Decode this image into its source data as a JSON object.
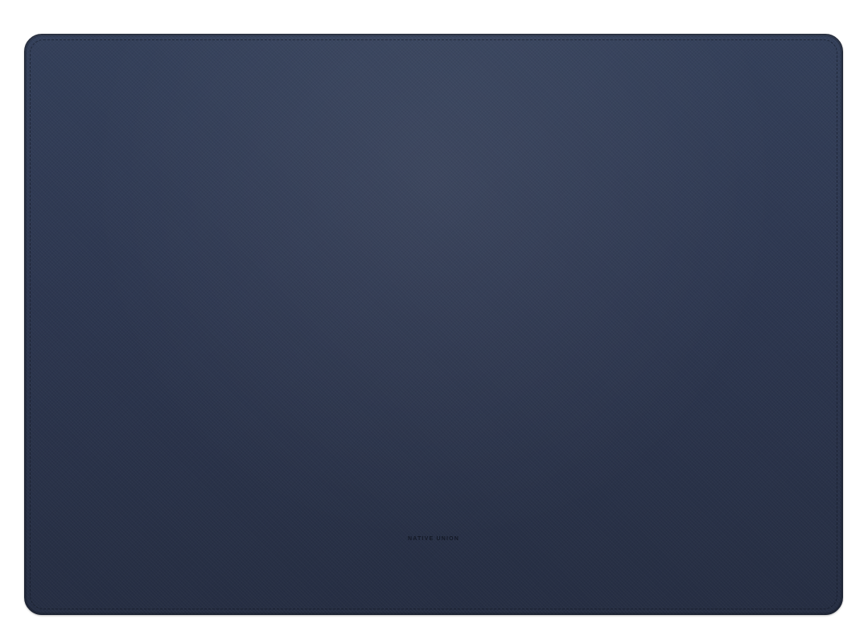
{
  "product": {
    "brand_mark": "NATIVE UNION",
    "colors": {
      "background": "#ffffff",
      "sleeve_fabric": "#2c3446",
      "stitching": "#121622",
      "logo": "#141926"
    }
  }
}
